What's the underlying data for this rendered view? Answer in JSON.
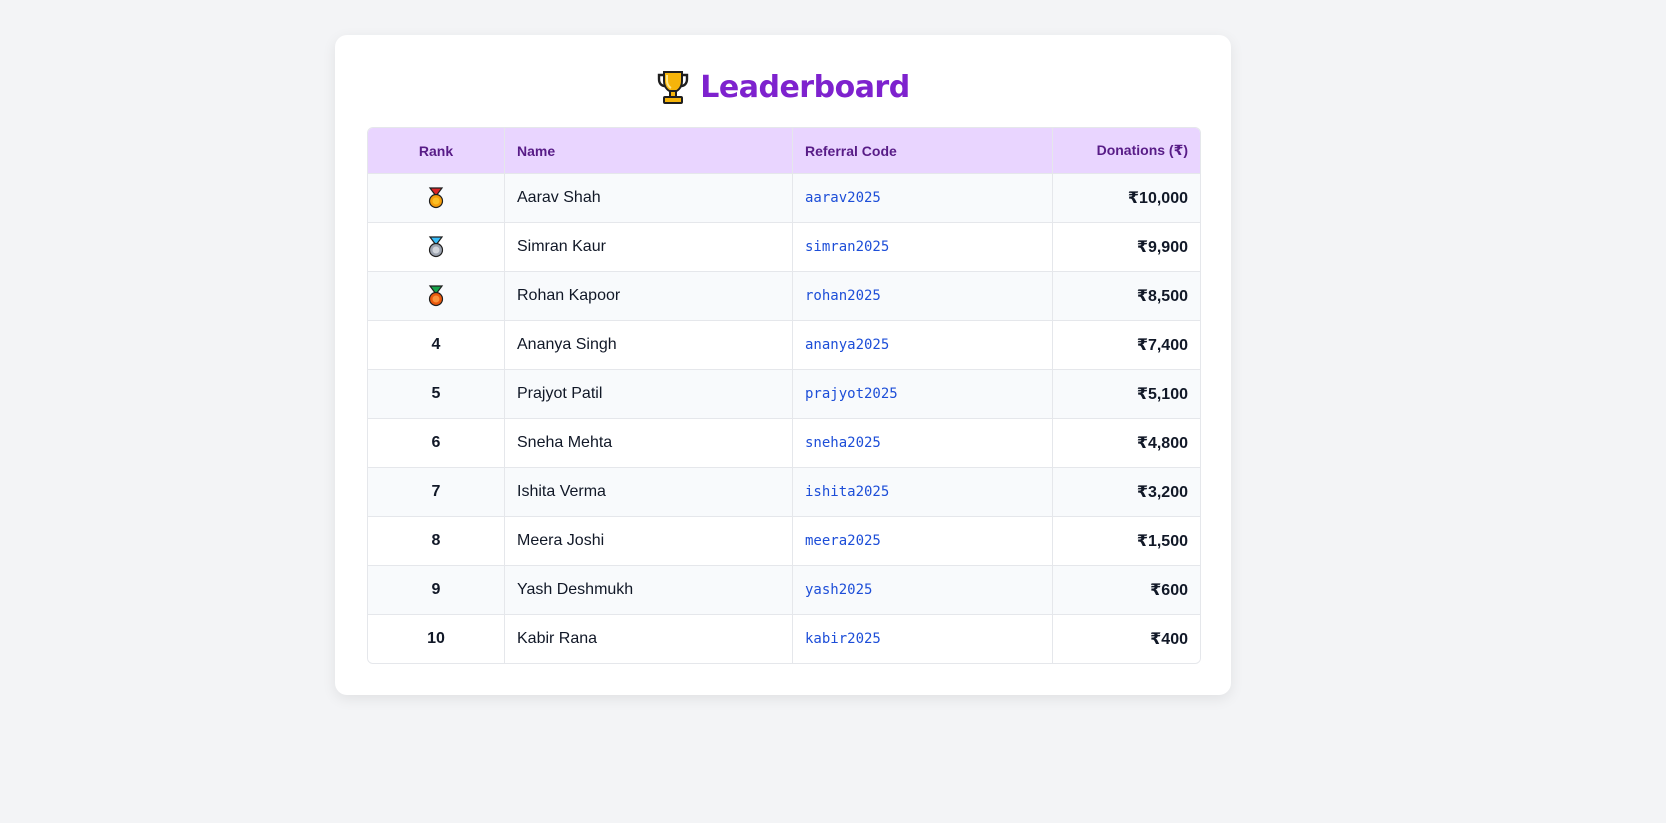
{
  "header": {
    "title": "Leaderboard",
    "icon": "trophy-icon"
  },
  "table": {
    "columns": [
      "Rank",
      "Name",
      "Referral Code",
      "Donations (₹)"
    ],
    "rows": [
      {
        "rank": "",
        "medal": "gold",
        "name": "Aarav Shah",
        "code": "aarav2025",
        "donation": "₹10,000"
      },
      {
        "rank": "",
        "medal": "silver",
        "name": "Simran Kaur",
        "code": "simran2025",
        "donation": "₹9,900"
      },
      {
        "rank": "",
        "medal": "bronze",
        "name": "Rohan Kapoor",
        "code": "rohan2025",
        "donation": "₹8,500"
      },
      {
        "rank": "4",
        "name": "Ananya Singh",
        "code": "ananya2025",
        "donation": "₹7,400"
      },
      {
        "rank": "5",
        "name": "Prajyot Patil",
        "code": "prajyot2025",
        "donation": "₹5,100"
      },
      {
        "rank": "6",
        "name": "Sneha Mehta",
        "code": "sneha2025",
        "donation": "₹4,800"
      },
      {
        "rank": "7",
        "name": "Ishita Verma",
        "code": "ishita2025",
        "donation": "₹3,200"
      },
      {
        "rank": "8",
        "name": "Meera Joshi",
        "code": "meera2025",
        "donation": "₹1,500"
      },
      {
        "rank": "9",
        "name": "Yash Deshmukh",
        "code": "yash2025",
        "donation": "₹600"
      },
      {
        "rank": "10",
        "name": "Kabir Rana",
        "code": "kabir2025",
        "donation": "₹400"
      }
    ]
  },
  "colors": {
    "title": "#7e22ce",
    "header_bg": "#e9d5ff",
    "header_text": "#581c87",
    "code_text": "#1d4ed8",
    "page_bg": "#f3f4f6"
  }
}
